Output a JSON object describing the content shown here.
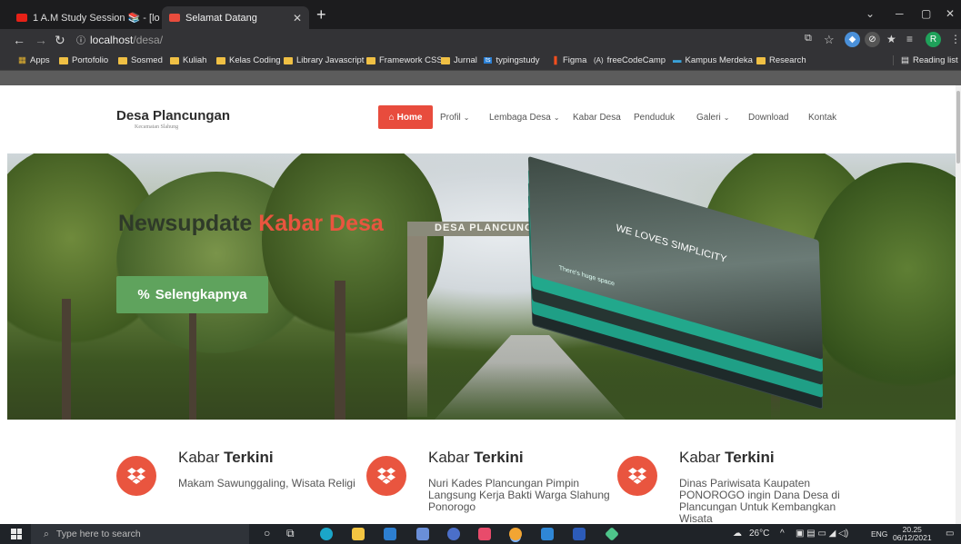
{
  "browser": {
    "tabs": [
      {
        "label": "1 A.M Study Session 📚 - [lo",
        "active": false
      },
      {
        "label": "Selamat Datang",
        "active": true
      }
    ],
    "new_tab": "+",
    "window_controls": {
      "minimize": "─",
      "maximize": "▢",
      "close": "✕",
      "tab_search": "⌄"
    },
    "address": {
      "host": "localhost",
      "path": "/desa/"
    },
    "profile_initial": "R",
    "bookmarks": [
      "Apps",
      "Portofolio",
      "Sosmed",
      "Kuliah",
      "Kelas Coding",
      "Library Javascript",
      "Framework CSS",
      "Jurnal",
      "typingstudy",
      "Figma",
      "freeCodeCamp",
      "Kampus Merdeka",
      "Research"
    ],
    "reading_list": "Reading list"
  },
  "site": {
    "brand": {
      "name": "Desa Plancungan",
      "subtitle": "Kecamatan Slahung"
    },
    "menu": [
      {
        "label": "Home",
        "active": true,
        "has_caret": false,
        "icon": "home-icon"
      },
      {
        "label": "Profil",
        "has_caret": true
      },
      {
        "label": "Lembaga Desa",
        "has_caret": true
      },
      {
        "label": "Kabar Desa",
        "has_caret": false
      },
      {
        "label": "Penduduk",
        "has_caret": false
      },
      {
        "label": "Galeri",
        "has_caret": true
      },
      {
        "label": "Download",
        "has_caret": false
      },
      {
        "label": "Kontak",
        "has_caret": false
      }
    ],
    "hero": {
      "title_prefix": "Newsupdate",
      "title_accent": "Kabar Desa",
      "button_label": "Selengkapnya",
      "gate_text": "DESA PLANCUNGAN",
      "mockup_text": "WE LOVES SIMPLICITY",
      "mockup_caption": "There's huge space"
    },
    "features": [
      {
        "title_light": "Kabar",
        "title_bold": "Terkini",
        "text": "Makam Sawunggaling, Wisata Religi"
      },
      {
        "title_light": "Kabar",
        "title_bold": "Terkini",
        "text": "Nuri Kades Plancungan Pimpin Langsung Kerja Bakti Warga Slahung Ponorogo"
      },
      {
        "title_light": "Kabar",
        "title_bold": "Terkini",
        "text": "Dinas Pariwisata Kaupaten PONOROGO ingin Dana Desa di Plancungan Untuk Kembangkan Wisata"
      }
    ],
    "colors": {
      "accent": "#e9553f",
      "button": "#5fa35d"
    }
  },
  "taskbar": {
    "search_placeholder": "Type here to search",
    "weather": "26°C",
    "language": "ENG",
    "time": "20.25",
    "date": "06/12/2021"
  }
}
